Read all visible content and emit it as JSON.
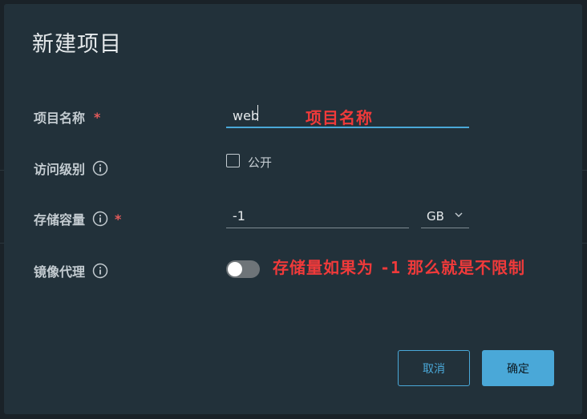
{
  "dialog": {
    "title": "新建项目",
    "fields": {
      "name": {
        "label": "项目名称",
        "required_mark": "*",
        "value": "web"
      },
      "access": {
        "label": "访问级别",
        "checkbox_label": "公开",
        "checked": false
      },
      "storage": {
        "label": "存储容量",
        "required_mark": "*",
        "value": "-1",
        "unit": "GB"
      },
      "proxy": {
        "label": "镜像代理",
        "enabled": false
      }
    },
    "buttons": {
      "cancel": "取消",
      "ok": "确定"
    }
  },
  "annotations": {
    "name_note": "项目名称",
    "storage_note_prefix": "存储量如果为",
    "storage_note_value": "-1",
    "storage_note_suffix": "那么就是不限制"
  },
  "colors": {
    "accent": "#4aa8d8",
    "required": "#e35a5a",
    "annotation": "#f03a3a",
    "dialog_bg": "#22313a"
  },
  "icons": [
    "info-icon",
    "chevron-down-icon"
  ]
}
